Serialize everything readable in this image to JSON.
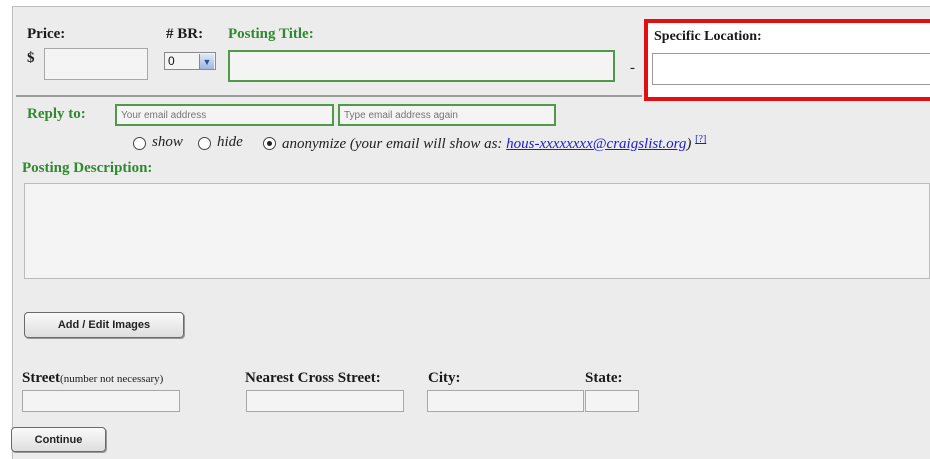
{
  "form": {
    "price_label": "Price:",
    "currency": "$",
    "br_label": "# BR:",
    "br_value": "0",
    "posting_title_label": "Posting Title:",
    "title_dash": "-",
    "specific_location_label": "Specific Location:",
    "reply_to_label": "Reply to:",
    "email_placeholder": "Your email address",
    "email_confirm_placeholder": "Type email address again",
    "privacy_options": [
      "show",
      "hide",
      "anonymize"
    ],
    "privacy_selected": "anonymize",
    "anonymize_note_prefix": "(your email will show as:",
    "anonymize_email": "hous-xxxxxxxx@craigslist.org",
    "anonymize_note_suffix": ")",
    "help_link": "[?]",
    "description_label": "Posting Description:",
    "add_images_button": "Add / Edit Images",
    "street_label": "Street",
    "street_note": "(number not necessary)",
    "cross_street_label": "Nearest Cross Street:",
    "city_label": "City:",
    "state_label": "State:",
    "continue_button": "Continue"
  },
  "colors": {
    "label_green": "#2f8a2f",
    "highlight_red": "#e01010",
    "panel_bg": "#ececec",
    "link_blue": "#1a1adb"
  }
}
